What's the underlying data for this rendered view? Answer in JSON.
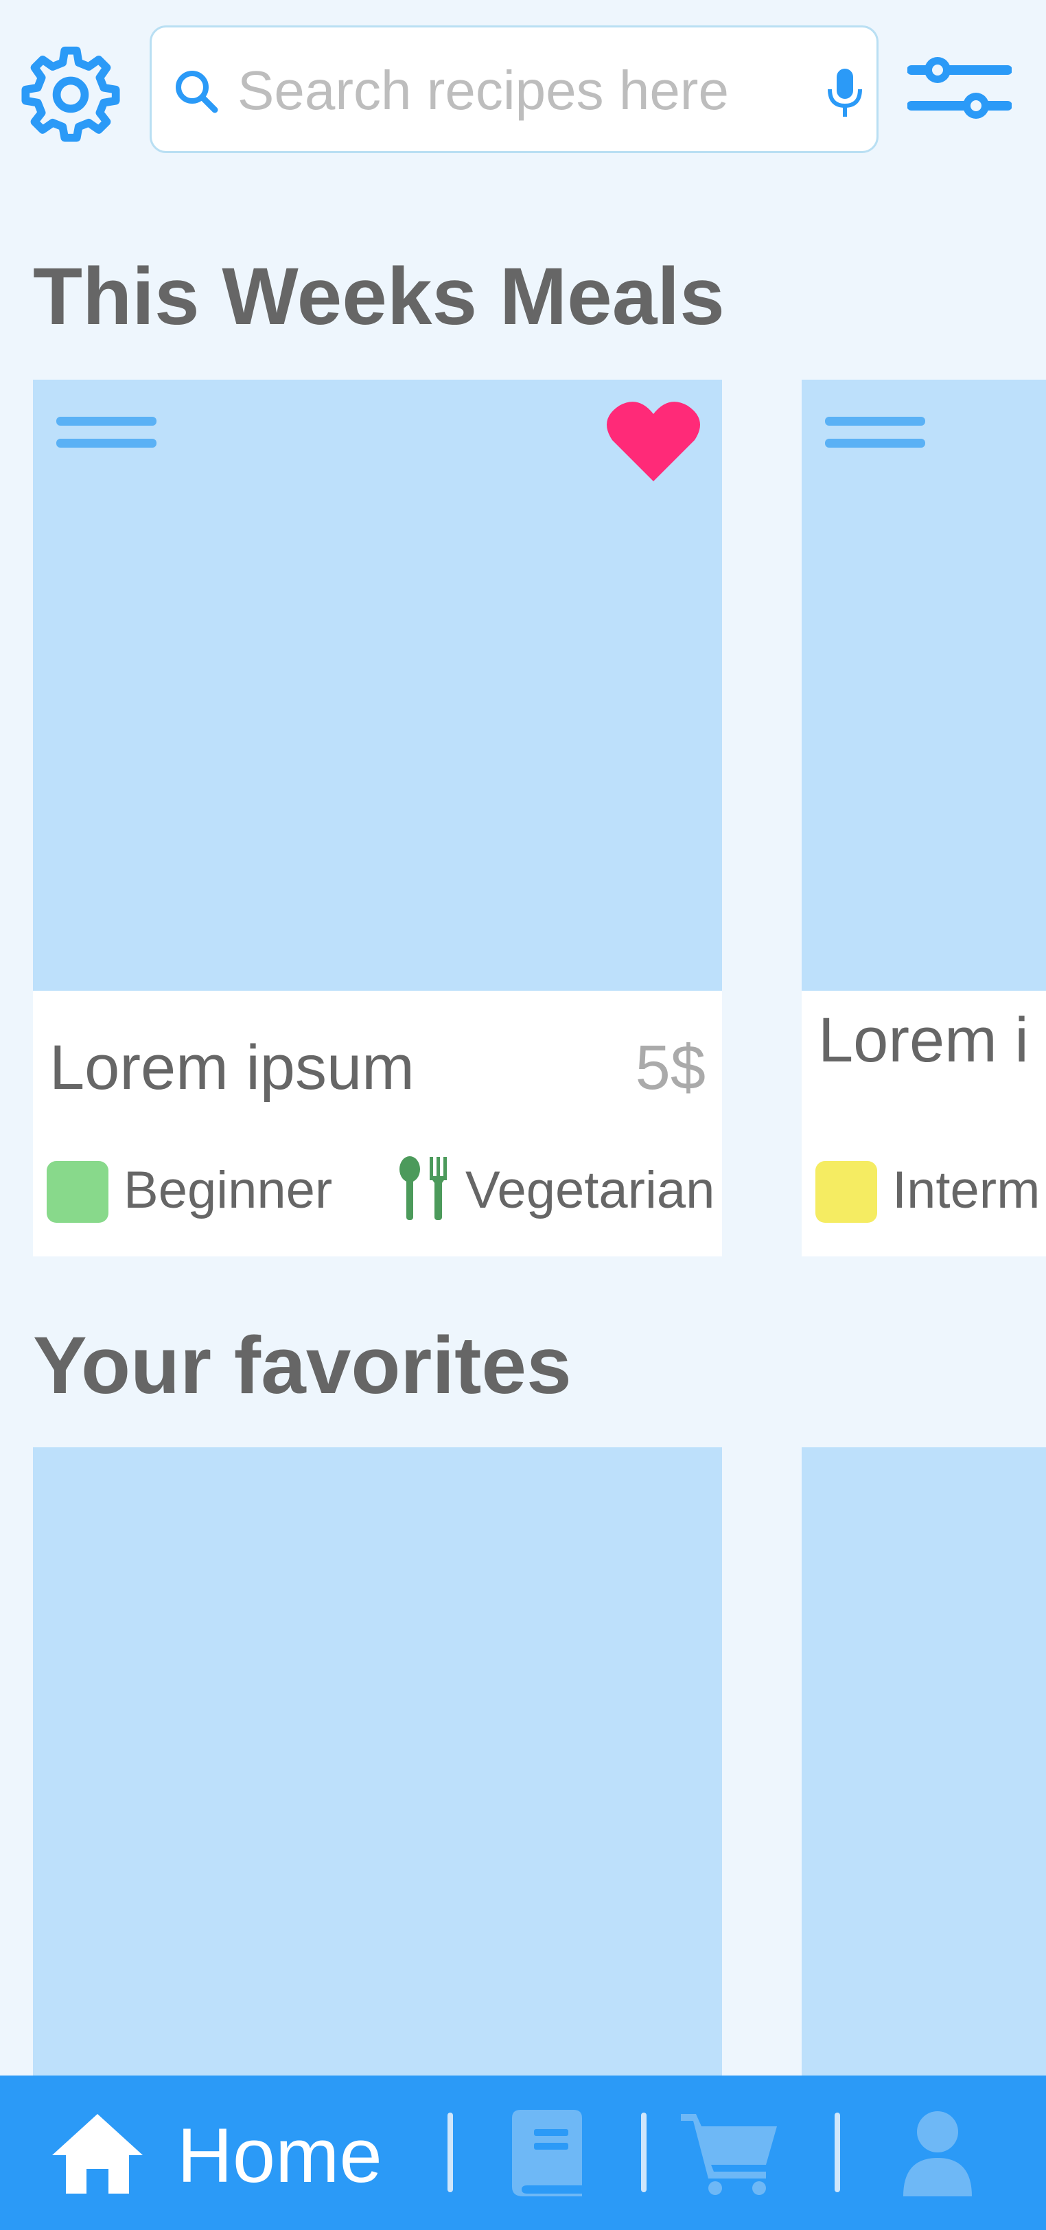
{
  "header": {
    "settings_icon": "gear-icon",
    "search": {
      "placeholder": "Search recipes here",
      "value": "",
      "search_icon": "search-icon",
      "voice_icon": "microphone-icon"
    },
    "filter_icon": "sliders-icon"
  },
  "sections": {
    "weekly": {
      "title": "This Weeks Meals",
      "cards": [
        {
          "title": "Lorem ipsum",
          "price": "5$",
          "difficulty": "Beginner",
          "difficulty_color": "#88d98b",
          "diet": "Vegetarian",
          "favorite": true
        },
        {
          "title": "Lorem i",
          "difficulty": "Interm",
          "difficulty_color": "#f5ec62"
        }
      ]
    },
    "favorites": {
      "title": "Your favorites"
    }
  },
  "bottom_nav": {
    "active_label": "Home",
    "items": [
      "home-icon",
      "recipe-book-icon",
      "cart-icon",
      "profile-icon"
    ]
  },
  "colors": {
    "accent": "#2b9af7",
    "background": "#eef6fd",
    "card_image": "#bde0fb",
    "heart": "#ff2a78",
    "diet_icon": "#4c9a5b"
  }
}
